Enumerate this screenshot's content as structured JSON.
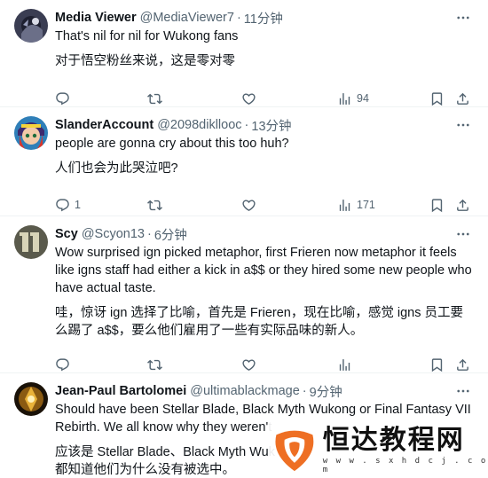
{
  "tweets": [
    {
      "name": "Media Viewer",
      "handle": "@MediaViewer7",
      "time": "11分钟",
      "text_en": "That's nil for nil for Wukong fans",
      "text_zh": "对于悟空粉丝来说，这是零对零",
      "replies": "",
      "retweets": "",
      "likes": "",
      "views": "94"
    },
    {
      "name": "SlanderAccount",
      "handle": "@2098dikllooc",
      "time": "13分钟",
      "text_en": "people are gonna cry about this too huh?",
      "text_zh": "人们也会为此哭泣吧?",
      "replies": "1",
      "retweets": "",
      "likes": "",
      "views": "171"
    },
    {
      "name": "Scy",
      "handle": "@Scyon13",
      "time": "6分钟",
      "text_en": "Wow surprised ign picked metaphor, first Frieren now metaphor it feels like igns staff had either a kick in a$$ or they hired some new people who have actual taste.",
      "text_zh": "哇，惊讶 ign 选择了比喻，首先是 Frieren，现在比喻，感觉 igns 员工要么踢了 a$$，要么他们雇用了一些有实际品味的新人。",
      "replies": "",
      "retweets": "",
      "likes": "",
      "views": ""
    },
    {
      "name": "Jean-Paul Bartolomei",
      "handle": "@ultimablackmage",
      "time": "9分钟",
      "text_en": "Should have been Stellar Blade, Black Myth Wukong or Final Fantasy VII Rebirth. We all know why they weren't",
      "text_zh": "应该是 Stellar Blade、Black Myth Wuk\n都知道他们为什么没有被选中。",
      "replies": "",
      "retweets": "",
      "likes": "",
      "views": ""
    }
  ],
  "watermark": {
    "title": "恒达教程网",
    "url": "w w w . s x h d c j . c o m"
  }
}
